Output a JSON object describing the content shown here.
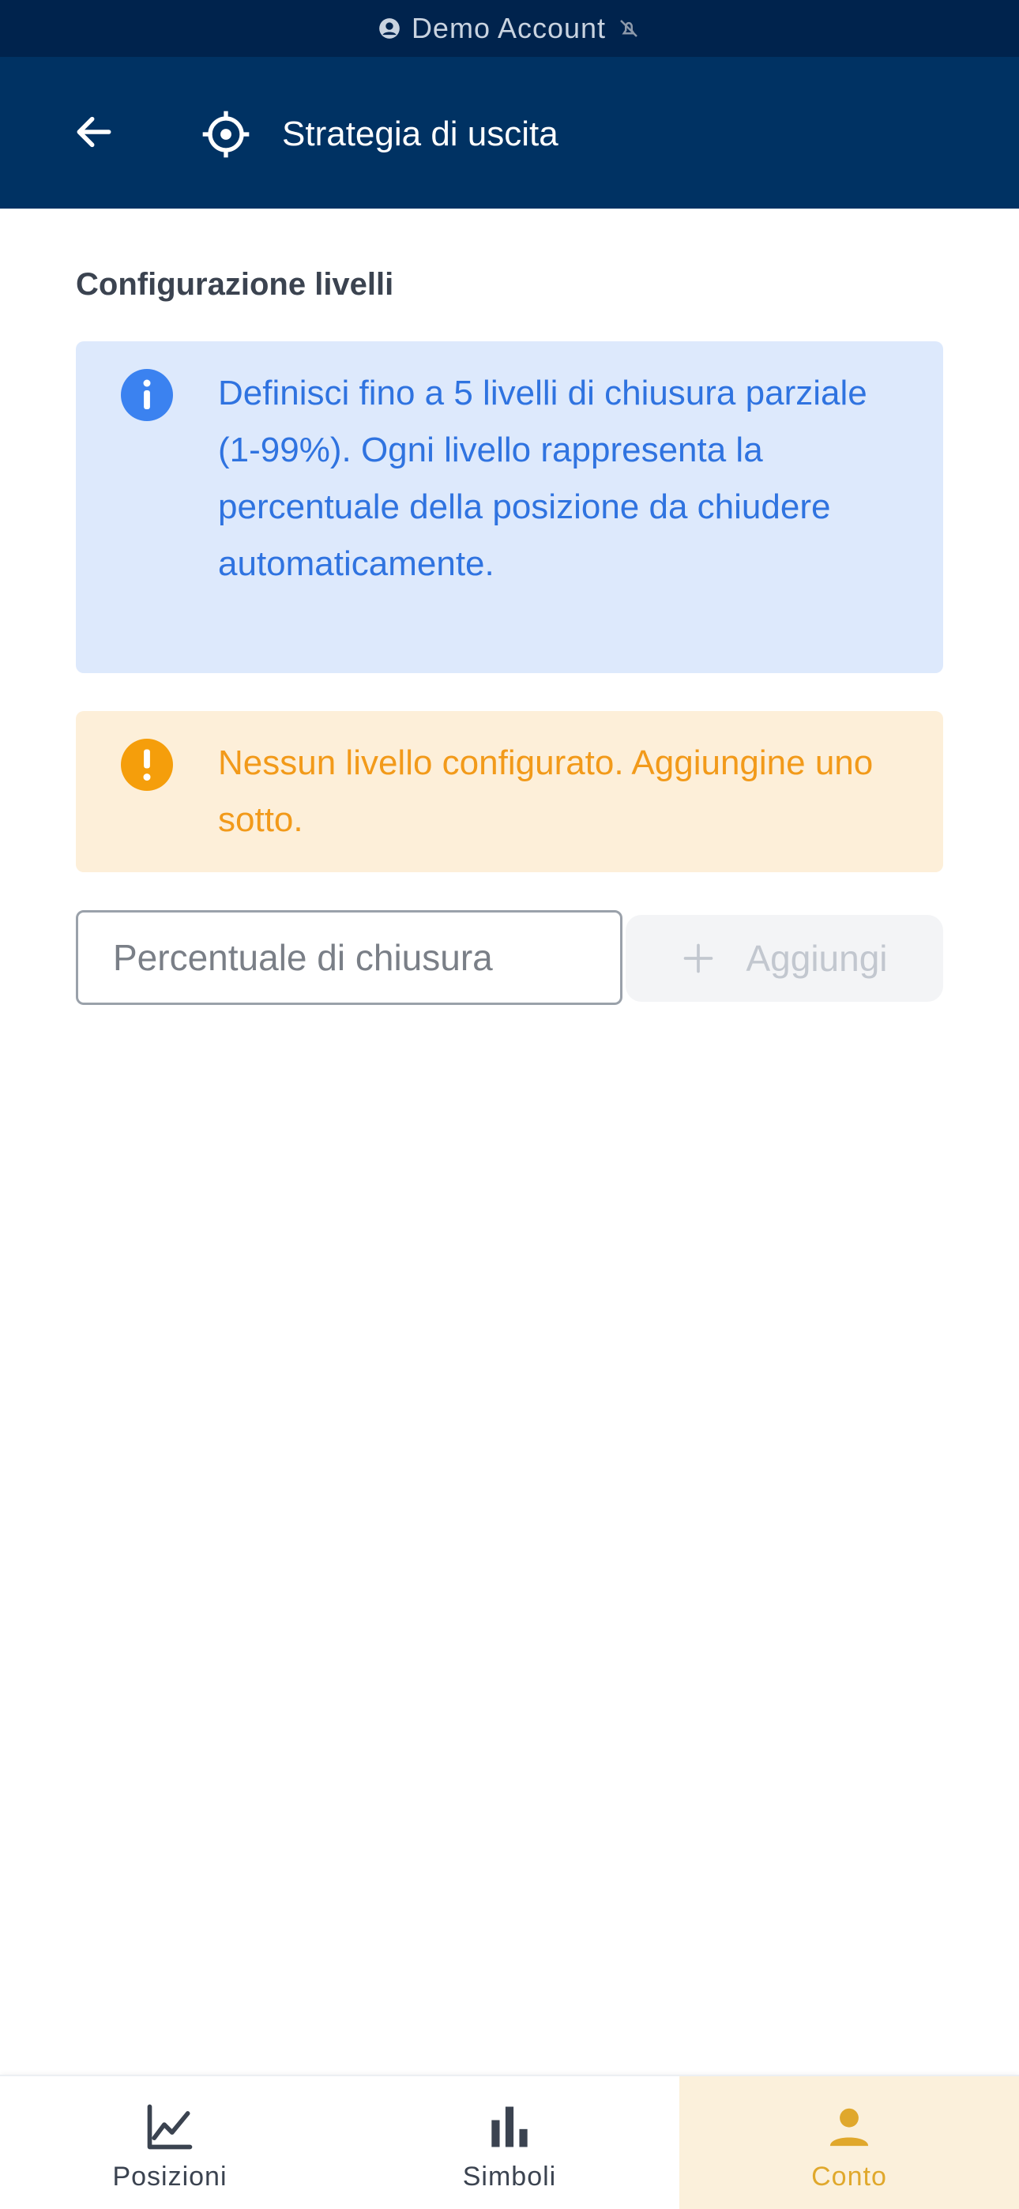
{
  "status_bar": {
    "account_label": "Demo Account",
    "account_icon": "account-circle-icon",
    "muted_icon": "muted-icon"
  },
  "app_bar": {
    "back_icon": "arrow-left-icon",
    "title_icon": "crosshair-icon",
    "title": "Strategia di uscita"
  },
  "main": {
    "section_title": "Configurazione livelli",
    "info_message": "Definisci fino a 5 livelli di chiusura parziale (1-99%). Ogni livello rappresenta la percentuale della posizione da chiudere automaticamente.",
    "warning_message": "Nessun livello configurato. Aggiungine uno sotto.",
    "percent_input": {
      "placeholder": "Percentuale di chiusura",
      "value": ""
    },
    "add_button_label": "Aggiungi"
  },
  "bottom_nav": {
    "items": [
      {
        "label": "Posizioni",
        "icon": "line-chart-icon",
        "active": false
      },
      {
        "label": "Simboli",
        "icon": "bar-chart-icon",
        "active": false
      },
      {
        "label": "Conto",
        "icon": "person-icon",
        "active": true
      }
    ]
  },
  "colors": {
    "status_bar_bg": "#00234d",
    "app_bar_bg": "#003263",
    "info_bg": "#dde9fc",
    "info_text": "#2f73e0",
    "warning_bg": "#fdefd9",
    "warning_text": "#f29a1a",
    "active_nav_bg": "#fbf0db",
    "active_nav_accent": "#e0a82c"
  }
}
